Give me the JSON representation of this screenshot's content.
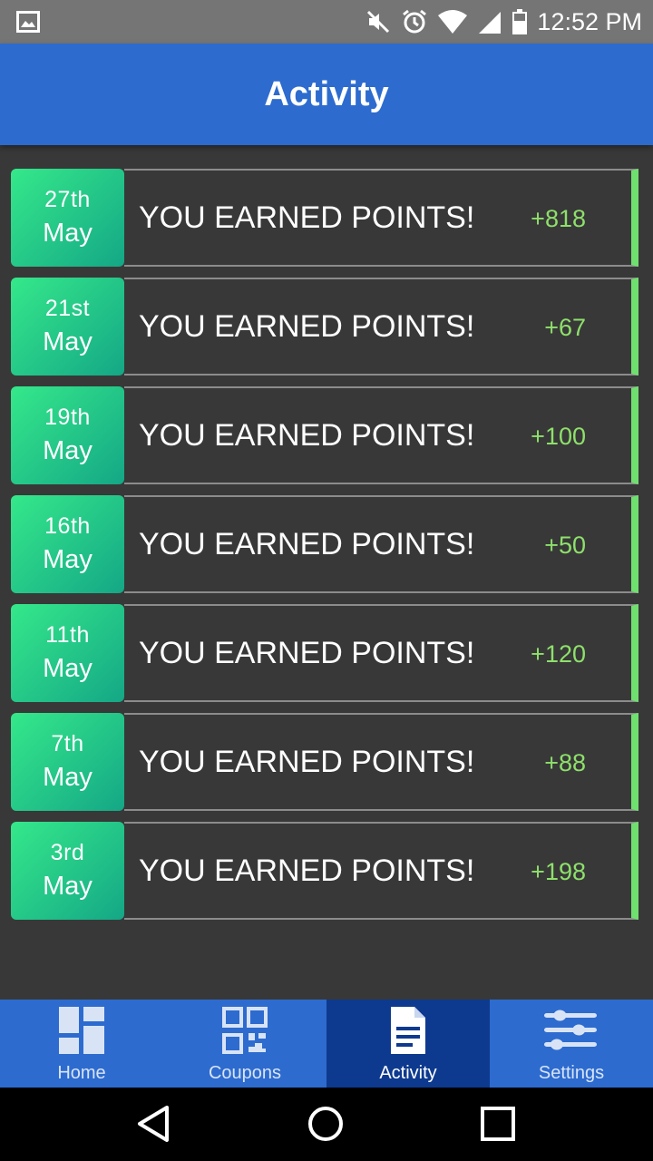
{
  "status_bar": {
    "time": "12:52 PM"
  },
  "app_bar": {
    "title": "Activity"
  },
  "activities": [
    {
      "day": "27th",
      "month": "May",
      "message": "YOU EARNED POINTS!",
      "points": "+818"
    },
    {
      "day": "21st",
      "month": "May",
      "message": "YOU EARNED POINTS!",
      "points": "+67"
    },
    {
      "day": "19th",
      "month": "May",
      "message": "YOU EARNED POINTS!",
      "points": "+100"
    },
    {
      "day": "16th",
      "month": "May",
      "message": "YOU EARNED POINTS!",
      "points": "+50"
    },
    {
      "day": "11th",
      "month": "May",
      "message": "YOU EARNED POINTS!",
      "points": "+120"
    },
    {
      "day": "7th",
      "month": "May",
      "message": "YOU EARNED POINTS!",
      "points": "+88"
    },
    {
      "day": "3rd",
      "month": "May",
      "message": "YOU EARNED POINTS!",
      "points": "+198"
    }
  ],
  "bottom_nav": {
    "home": {
      "label": "Home",
      "icon": "dashboard-icon"
    },
    "coupons": {
      "label": "Coupons",
      "icon": "qr-code-icon"
    },
    "activity": {
      "label": "Activity",
      "icon": "document-icon",
      "active": true
    },
    "settings": {
      "label": "Settings",
      "icon": "sliders-icon"
    }
  },
  "colors": {
    "app_bar": "#2d6bcf",
    "nav_active": "#0d3a8e",
    "background": "#383838",
    "points": "#8ee06b",
    "accent_bar": "#6fe06f",
    "date_gradient_start": "#35e88a",
    "date_gradient_end": "#14a786"
  }
}
